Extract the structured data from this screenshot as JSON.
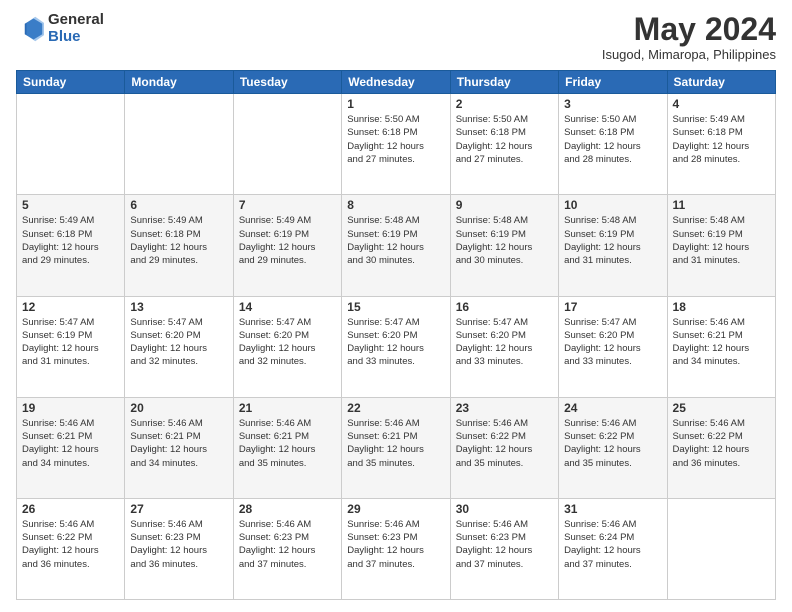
{
  "header": {
    "logo_general": "General",
    "logo_blue": "Blue",
    "title": "May 2024",
    "location": "Isugod, Mimaropa, Philippines"
  },
  "weekdays": [
    "Sunday",
    "Monday",
    "Tuesday",
    "Wednesday",
    "Thursday",
    "Friday",
    "Saturday"
  ],
  "weeks": [
    [
      {
        "day": "",
        "info": ""
      },
      {
        "day": "",
        "info": ""
      },
      {
        "day": "",
        "info": ""
      },
      {
        "day": "1",
        "info": "Sunrise: 5:50 AM\nSunset: 6:18 PM\nDaylight: 12 hours\nand 27 minutes."
      },
      {
        "day": "2",
        "info": "Sunrise: 5:50 AM\nSunset: 6:18 PM\nDaylight: 12 hours\nand 27 minutes."
      },
      {
        "day": "3",
        "info": "Sunrise: 5:50 AM\nSunset: 6:18 PM\nDaylight: 12 hours\nand 28 minutes."
      },
      {
        "day": "4",
        "info": "Sunrise: 5:49 AM\nSunset: 6:18 PM\nDaylight: 12 hours\nand 28 minutes."
      }
    ],
    [
      {
        "day": "5",
        "info": "Sunrise: 5:49 AM\nSunset: 6:18 PM\nDaylight: 12 hours\nand 29 minutes."
      },
      {
        "day": "6",
        "info": "Sunrise: 5:49 AM\nSunset: 6:18 PM\nDaylight: 12 hours\nand 29 minutes."
      },
      {
        "day": "7",
        "info": "Sunrise: 5:49 AM\nSunset: 6:19 PM\nDaylight: 12 hours\nand 29 minutes."
      },
      {
        "day": "8",
        "info": "Sunrise: 5:48 AM\nSunset: 6:19 PM\nDaylight: 12 hours\nand 30 minutes."
      },
      {
        "day": "9",
        "info": "Sunrise: 5:48 AM\nSunset: 6:19 PM\nDaylight: 12 hours\nand 30 minutes."
      },
      {
        "day": "10",
        "info": "Sunrise: 5:48 AM\nSunset: 6:19 PM\nDaylight: 12 hours\nand 31 minutes."
      },
      {
        "day": "11",
        "info": "Sunrise: 5:48 AM\nSunset: 6:19 PM\nDaylight: 12 hours\nand 31 minutes."
      }
    ],
    [
      {
        "day": "12",
        "info": "Sunrise: 5:47 AM\nSunset: 6:19 PM\nDaylight: 12 hours\nand 31 minutes."
      },
      {
        "day": "13",
        "info": "Sunrise: 5:47 AM\nSunset: 6:20 PM\nDaylight: 12 hours\nand 32 minutes."
      },
      {
        "day": "14",
        "info": "Sunrise: 5:47 AM\nSunset: 6:20 PM\nDaylight: 12 hours\nand 32 minutes."
      },
      {
        "day": "15",
        "info": "Sunrise: 5:47 AM\nSunset: 6:20 PM\nDaylight: 12 hours\nand 33 minutes."
      },
      {
        "day": "16",
        "info": "Sunrise: 5:47 AM\nSunset: 6:20 PM\nDaylight: 12 hours\nand 33 minutes."
      },
      {
        "day": "17",
        "info": "Sunrise: 5:47 AM\nSunset: 6:20 PM\nDaylight: 12 hours\nand 33 minutes."
      },
      {
        "day": "18",
        "info": "Sunrise: 5:46 AM\nSunset: 6:21 PM\nDaylight: 12 hours\nand 34 minutes."
      }
    ],
    [
      {
        "day": "19",
        "info": "Sunrise: 5:46 AM\nSunset: 6:21 PM\nDaylight: 12 hours\nand 34 minutes."
      },
      {
        "day": "20",
        "info": "Sunrise: 5:46 AM\nSunset: 6:21 PM\nDaylight: 12 hours\nand 34 minutes."
      },
      {
        "day": "21",
        "info": "Sunrise: 5:46 AM\nSunset: 6:21 PM\nDaylight: 12 hours\nand 35 minutes."
      },
      {
        "day": "22",
        "info": "Sunrise: 5:46 AM\nSunset: 6:21 PM\nDaylight: 12 hours\nand 35 minutes."
      },
      {
        "day": "23",
        "info": "Sunrise: 5:46 AM\nSunset: 6:22 PM\nDaylight: 12 hours\nand 35 minutes."
      },
      {
        "day": "24",
        "info": "Sunrise: 5:46 AM\nSunset: 6:22 PM\nDaylight: 12 hours\nand 35 minutes."
      },
      {
        "day": "25",
        "info": "Sunrise: 5:46 AM\nSunset: 6:22 PM\nDaylight: 12 hours\nand 36 minutes."
      }
    ],
    [
      {
        "day": "26",
        "info": "Sunrise: 5:46 AM\nSunset: 6:22 PM\nDaylight: 12 hours\nand 36 minutes."
      },
      {
        "day": "27",
        "info": "Sunrise: 5:46 AM\nSunset: 6:23 PM\nDaylight: 12 hours\nand 36 minutes."
      },
      {
        "day": "28",
        "info": "Sunrise: 5:46 AM\nSunset: 6:23 PM\nDaylight: 12 hours\nand 37 minutes."
      },
      {
        "day": "29",
        "info": "Sunrise: 5:46 AM\nSunset: 6:23 PM\nDaylight: 12 hours\nand 37 minutes."
      },
      {
        "day": "30",
        "info": "Sunrise: 5:46 AM\nSunset: 6:23 PM\nDaylight: 12 hours\nand 37 minutes."
      },
      {
        "day": "31",
        "info": "Sunrise: 5:46 AM\nSunset: 6:24 PM\nDaylight: 12 hours\nand 37 minutes."
      },
      {
        "day": "",
        "info": ""
      }
    ]
  ]
}
